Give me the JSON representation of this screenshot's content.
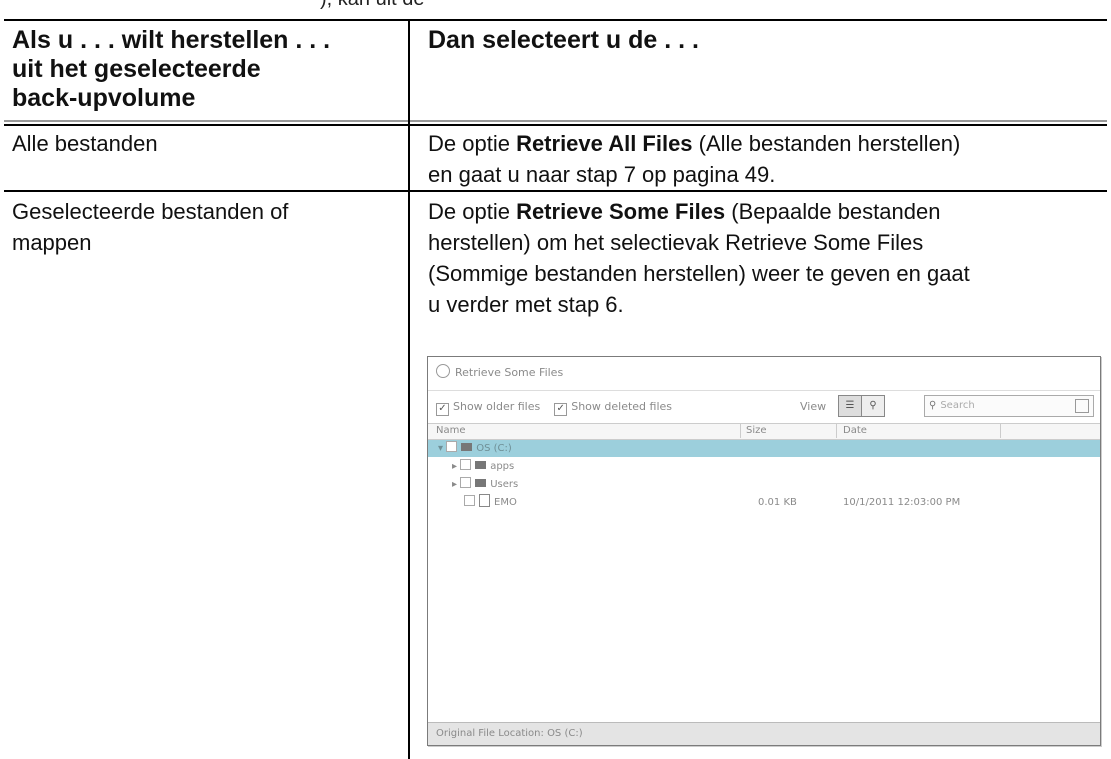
{
  "top_fragment": "), kan uit de",
  "table": {
    "header_left": [
      "Als u . . . wilt herstellen . . .",
      "uit het geselecteerde",
      "back-upvolume"
    ],
    "header_right": "Dan selecteert u de . . .",
    "rows": [
      {
        "left": "Alle bestanden",
        "right": {
          "prefix": "De optie ",
          "bold": "Retrieve All Files",
          "line1_suffix": " (Alle bestanden herstellen)",
          "line2": "en gaat u naar stap 7 op pagina 49."
        }
      },
      {
        "left": [
          "Geselecteerde bestanden of",
          "mappen"
        ],
        "right": {
          "prefix": "De optie ",
          "bold": "Retrieve Some Files",
          "line1_suffix": " (Bepaalde bestanden",
          "line2": "herstellen) om het selectievak Retrieve Some Files",
          "line3": "(Sommige bestanden herstellen) weer te geven en gaat",
          "line4": "u verder met stap 6."
        }
      }
    ]
  },
  "screenshot": {
    "title": "Retrieve Some Files",
    "show_older": "Show older files",
    "show_deleted": "Show deleted files",
    "view_label": "View",
    "search_placeholder": "Search",
    "columns": {
      "name": "Name",
      "size": "Size",
      "date": "Date"
    },
    "rows": [
      {
        "name": "OS (C:)",
        "size": "",
        "date": "",
        "selected": true,
        "type": "folder"
      },
      {
        "name": "apps",
        "size": "",
        "date": "",
        "type": "folder"
      },
      {
        "name": "Users",
        "size": "",
        "date": "",
        "type": "folder"
      },
      {
        "name": "EMO",
        "size": "0.01 KB",
        "date": "10/1/2011 12:03:00 PM",
        "type": "file"
      }
    ],
    "status": "Original File Location:   OS (C:)"
  }
}
